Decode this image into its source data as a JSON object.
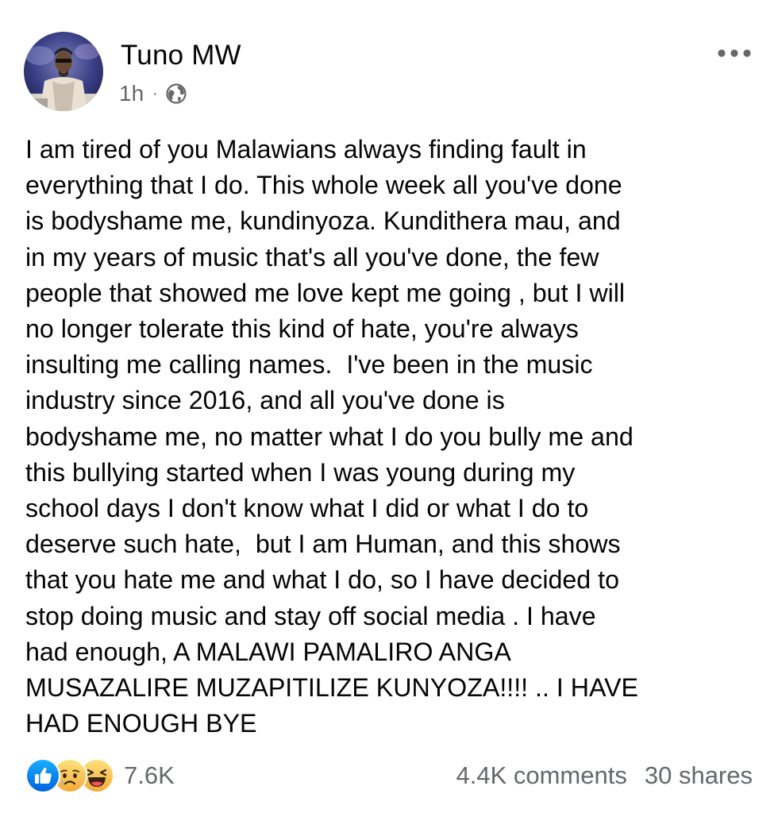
{
  "post": {
    "author": "Tuno MW",
    "timestamp": "1h",
    "separator": "·",
    "audience_icon": "globe-icon",
    "more_icon": "more-options-icon",
    "body_lines": [
      "I am tired of you Malawians always finding fault in",
      "everything that I do. This whole week all you've done",
      "is bodyshame me, kundinyoza. Kundithera mau, and",
      "in my years of music that's all you've done, the few",
      "people that showed me love kept me going , but I will",
      "no longer tolerate this kind of hate, you're always",
      "insulting me calling names.  I've been in the music",
      "industry since 2016, and all you've done is",
      "bodyshame me, no matter what I do you bully me and",
      "this bullying started when I was young during my",
      "school days I don't know what I did or what I do to",
      "deserve such hate,  but I am Human, and this shows",
      "that you hate me and what I do, so I have decided to",
      "stop doing music and stay off social media . I have",
      "had enough, A MALAWI PAMALIRO ANGA",
      "MUSAZALIRE MUZAPITILIZE KUNYOZA!!!! .. I HAVE",
      "HAD ENOUGH BYE"
    ]
  },
  "footer": {
    "reaction_icons": [
      "like-icon",
      "sad-icon",
      "haha-icon"
    ],
    "reaction_count": "7.6K",
    "comments": "4.4K comments",
    "shares": "30 shares"
  },
  "colors": {
    "text_primary": "#050505",
    "text_secondary": "#65676b",
    "like_blue": "#1877f2",
    "emoji_yellow": "#f7c23a"
  }
}
